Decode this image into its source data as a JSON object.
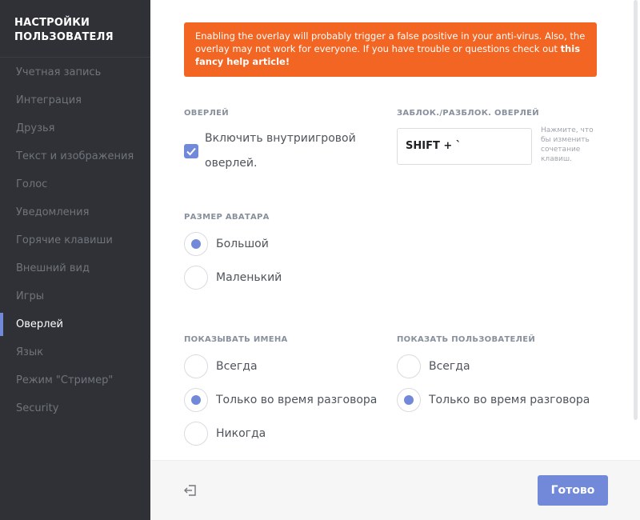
{
  "sidebar": {
    "title_line1": "НАСТРОЙКИ",
    "title_line2": "ПОЛЬЗОВАТЕЛЯ",
    "items": [
      {
        "label": "Учетная запись"
      },
      {
        "label": "Интеграция"
      },
      {
        "label": "Друзья"
      },
      {
        "label": "Текст и изображения"
      },
      {
        "label": "Голос"
      },
      {
        "label": "Уведомления"
      },
      {
        "label": "Горячие клавиши"
      },
      {
        "label": "Внешний вид"
      },
      {
        "label": "Игры"
      },
      {
        "label": "Оверлей",
        "active": true
      },
      {
        "label": "Язык"
      },
      {
        "label": "Режим \"Стример\""
      },
      {
        "label": "Security"
      }
    ]
  },
  "warning": {
    "text": "Enabling the overlay will probably trigger a false positive in your anti-virus. Also, the overlay may not work for everyone. If you have trouble or questions check out ",
    "link": "this fancy help article!"
  },
  "overlay": {
    "section_title": "Оверлей",
    "enable_label_line1": "Включить внутриигровой",
    "enable_label_line2": "оверлей.",
    "enabled": true
  },
  "toggle": {
    "section_title": "Заблок./разблок. оверлей",
    "keybind": "SHIFT + `",
    "hint": "Нажмите, что бы изменить сочетание клавиш."
  },
  "avatar_size": {
    "section_title": "Размер аватара",
    "options": [
      {
        "label": "Большой",
        "selected": true
      },
      {
        "label": "Маленький",
        "selected": false
      }
    ]
  },
  "show_names": {
    "section_title": "Показывать имена",
    "options": [
      {
        "label": "Всегда",
        "selected": false
      },
      {
        "label": "Только во время разговора",
        "selected": true
      },
      {
        "label": "Никогда",
        "selected": false
      }
    ]
  },
  "show_users": {
    "section_title": "Показать пользователей",
    "options": [
      {
        "label": "Всегда",
        "selected": false
      },
      {
        "label": "Только во время разговора",
        "selected": true
      }
    ]
  },
  "footer": {
    "done_label": "Готово",
    "exit_icon": "exit-icon"
  },
  "colors": {
    "accent": "#7289da",
    "warning": "#f26522",
    "sidebar": "#2f3136"
  }
}
